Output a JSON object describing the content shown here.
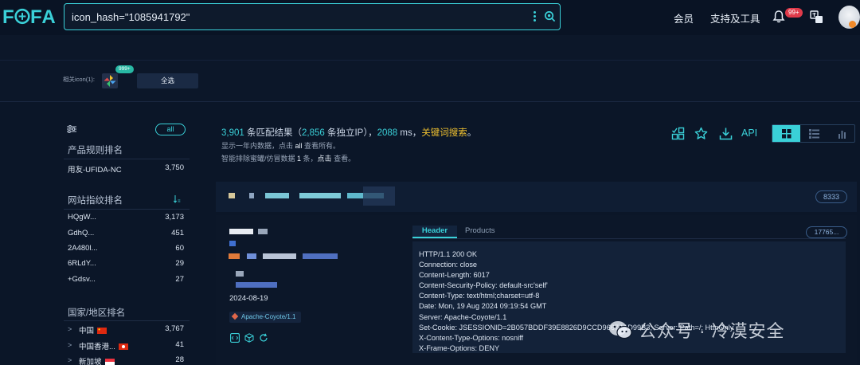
{
  "header": {
    "logo_text": "FOFA",
    "search": {
      "value": "icon_hash=\"1085941792\""
    },
    "nav": {
      "member": "会员",
      "tools": "支持及工具"
    },
    "notification_count": "99+",
    "accent": "#3ad0d8"
  },
  "icon_strip": {
    "label": "相关icon(1):",
    "badge": "999+",
    "select_all": "全选"
  },
  "sidebar": {
    "all_label": "all",
    "product_rank": {
      "title": "产品规则排名",
      "items": [
        {
          "name": "用友-UFIDA-NC",
          "count": "3,750"
        }
      ]
    },
    "fingerprint_rank": {
      "title": "网站指纹排名",
      "items": [
        {
          "name": "HQgW...",
          "count": "3,173"
        },
        {
          "name": "GdhQ...",
          "count": "451"
        },
        {
          "name": "2A480l...",
          "count": "60"
        },
        {
          "name": "6RLdY...",
          "count": "29"
        },
        {
          "name": "+Gdsv...",
          "count": "27"
        }
      ]
    },
    "country_rank": {
      "title": "国家/地区排名",
      "items": [
        {
          "name": "中国",
          "count": "3,767"
        },
        {
          "name": "中国香港...",
          "count": "41"
        },
        {
          "name": "新加坡",
          "count": "28"
        }
      ]
    }
  },
  "results": {
    "count": "3,901",
    "count_suffix": " 条匹配结果（",
    "ip_count": "2,856",
    "ip_suffix": " 条独立IP），",
    "time_ms": "2088",
    "time_suffix": " ms，",
    "keyword_search": "关键词搜索",
    "period": "。",
    "line2_pre": "显示一年内数据，点击 ",
    "line2_link": "all",
    "line2_post": " 查看所有。",
    "line3_pre": "智能排除蜜罐/仿冒数据 ",
    "line3_num": "1",
    "line3_mid": " 条，",
    "line3_link": "点击",
    "line3_post": " 查看。",
    "api_label": "API"
  },
  "card": {
    "port_count": "8333",
    "date": "2024-08-19",
    "server_tag": "Apache-Coyote/1.1",
    "tabs": {
      "header": "Header",
      "products": "Products"
    },
    "ip_pill": "17765...",
    "response_lines": [
      "HTTP/1.1 200 OK",
      "Connection: close",
      "Content-Length: 6017",
      "Content-Security-Policy: default-src'self'",
      "Content-Type: text/html;charset=utf-8",
      "Date: Mon, 19 Aug 2024 09:19:54 GMT",
      "Server: Apache-Coyote/1.1",
      "Set-Cookie: JSESSIONID=2B057BDDF39E8826D9CCD9667A1D99B3; Server: Path=/; HttpOnly",
      "X-Content-Type-Options: nosniff",
      "X-Frame-Options: DENY"
    ]
  },
  "watermark": {
    "text": "公众号 · 冷漠安全"
  }
}
